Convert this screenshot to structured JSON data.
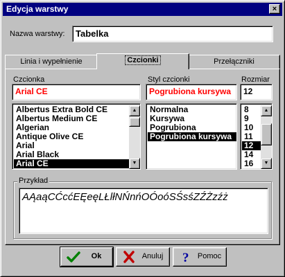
{
  "window": {
    "title": "Edycja warstwy",
    "close_glyph": "×"
  },
  "layer_name": {
    "label": "Nazwa warstwy:",
    "value": "Tabelka"
  },
  "tabs": [
    {
      "label": "Linia i wypełnienie"
    },
    {
      "label": "Czcionki"
    },
    {
      "label": "Przełączniki"
    }
  ],
  "font": {
    "label": "Czcionka",
    "value": "Arial CE",
    "items": [
      "Albertus Extra Bold CE",
      "Albertus Medium CE",
      "Algerian",
      "Antique Olive CE",
      "Arial",
      "Arial Black",
      "Arial CE"
    ],
    "selected_index": 6
  },
  "style": {
    "label": "Styl czcionki",
    "value": "Pogrubiona kursywa",
    "items": [
      "Normalna",
      "Kursywa",
      "Pogrubiona",
      "Pogrubiona kursywa"
    ],
    "selected_index": 3
  },
  "size": {
    "label": "Rozmiar",
    "value": "12",
    "items": [
      "8",
      "9",
      "10",
      "11",
      "12",
      "14",
      "16"
    ],
    "selected_index": 4
  },
  "preview": {
    "label": "Przykład",
    "text": "AĄaąCĆcćEĘeęLŁlłNŃnńOÓoóSŚsśZŹŻzźż"
  },
  "buttons": {
    "ok": "Ok",
    "cancel": "Anuluj",
    "help": "Pomoc"
  },
  "colors": {
    "title_bar": "#000080",
    "selection": "#000000",
    "field_red": "#ff0000",
    "ok_icon": "#008000",
    "cancel_icon": "#c00000",
    "help_icon": "#0000a0"
  },
  "icons": {
    "ok": "checkmark-icon",
    "cancel": "x-mark-icon",
    "help": "question-mark-icon"
  }
}
